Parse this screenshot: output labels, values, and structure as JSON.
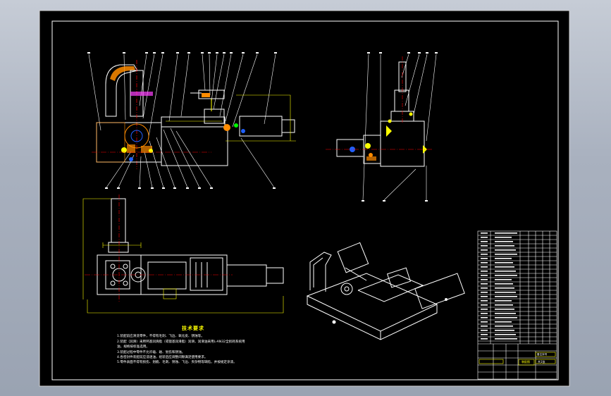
{
  "drawing": {
    "tech_req_title": "技术要求",
    "tech_notes": [
      "1.装配前应清洗零件，不得有毛刺、飞边、氧化皮、锈蚀等。",
      "2.装配（润滑）采用钙基润滑脂（或锂基润滑脂）润滑，润滑油采用L-AN32全损耗系统用油，规格按标准选用。",
      "3.装配过程中零件不允许磕、碰、划伤和锈蚀。",
      "4.各密封件装配前应浸透油，组装后应调整间隙满足使用要求。",
      "5.零件表面不得有损伤、划痕、毛刺、锈蚀、飞边、夹杂物等缺陷，并按规定涂漆。"
    ],
    "title_block": {
      "small_header": "备注序号",
      "name_cell": "装配图",
      "sheet_cell": "共1张"
    }
  },
  "colors": {
    "background": "#000000",
    "frame": "#ffffff",
    "dimension": "#ffff00",
    "center_line": "#ff0000",
    "leader": "#ffffff",
    "hatch": "#ff8c00",
    "accent_blue": "#2060ff",
    "accent_green": "#00ff00",
    "accent_magenta": "#ff40ff"
  }
}
